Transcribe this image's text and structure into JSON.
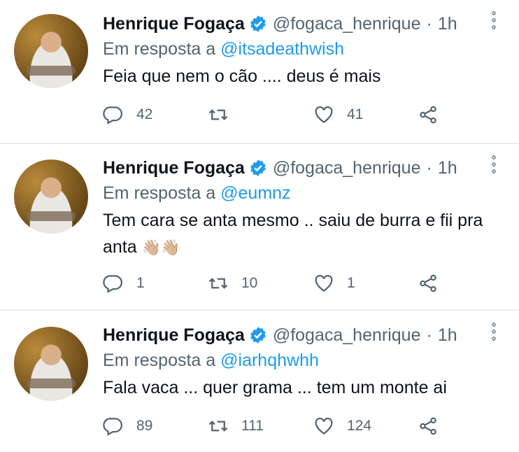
{
  "colors": {
    "link": "#1d9bf0",
    "muted": "#536471",
    "verified": "#1d9bf0"
  },
  "tweets": [
    {
      "name": "Henrique Fogaça",
      "handle": "@fogaca_henrique",
      "separator": "·",
      "time": "1h",
      "reply_prefix": "Em resposta a",
      "reply_to": "@itsadeathwish",
      "text": "Feia que nem o cão .... deus é mais",
      "text2": "",
      "emoji": "",
      "replies": "42",
      "retweets": "",
      "likes": "41"
    },
    {
      "name": "Henrique Fogaça",
      "handle": "@fogaca_henrique",
      "separator": "·",
      "time": "1h",
      "reply_prefix": "Em resposta a",
      "reply_to": "@eumnz",
      "text": "Tem cara se anta mesmo .. saiu de burra e fii pra",
      "text2": "anta ",
      "emoji": "👋🏼👋🏼",
      "replies": "1",
      "retweets": "10",
      "likes": "1"
    },
    {
      "name": "Henrique Fogaça",
      "handle": "@fogaca_henrique",
      "separator": "·",
      "time": "1h",
      "reply_prefix": "Em resposta a",
      "reply_to": "@iarhqhwhh",
      "text": "Fala vaca ... quer grama ... tem um monte ai",
      "text2": "",
      "emoji": "",
      "replies": "89",
      "retweets": "111",
      "likes": "124"
    }
  ],
  "icons": {
    "reply": "reply-icon",
    "retweet": "retweet-icon",
    "like": "heart-icon",
    "share": "share-icon",
    "verified": "verified-badge-icon",
    "more": "more-options-icon"
  }
}
